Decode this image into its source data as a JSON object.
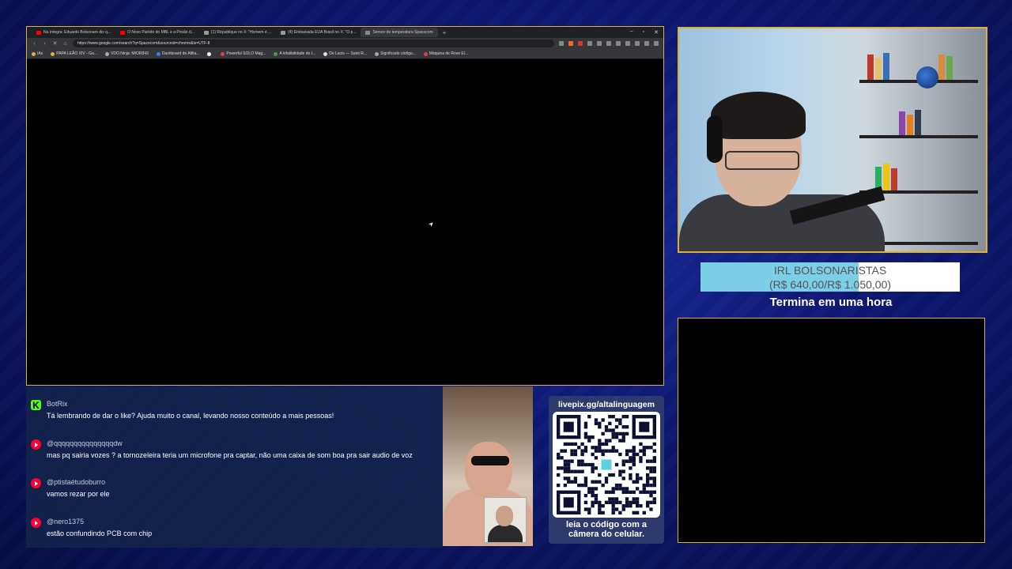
{
  "browser": {
    "tabs": [
      {
        "label": "Na íntegra: Eduardo Bolsonaro diz q...",
        "favicon": "#ff0000",
        "active": false
      },
      {
        "label": "O Novo Partido do MBL e a Prisão d...",
        "favicon": "#ff0000",
        "active": false
      },
      {
        "label": "(1) République no X: \"Homem é ...",
        "favicon": "#999999",
        "active": false
      },
      {
        "label": "(4) Embaixada EUA Brasil no X: \"O p...",
        "favicon": "#999999",
        "active": false
      },
      {
        "label": "Sensor de temperatura Spacecom",
        "favicon": "#888888",
        "active": true
      }
    ],
    "new_tab": "+",
    "window_controls": {
      "minimize": "−",
      "maximize": "▫",
      "close": "✕"
    },
    "nav": {
      "back": "‹",
      "forward": "›",
      "stop": "✕",
      "home": "⌂"
    },
    "url": "https://www.google.com/search?q=Spacecom&sourceid=chrome&ie=UTF-8",
    "bookmarks": [
      {
        "label": "IAs",
        "color": "#e0b040"
      },
      {
        "label": "PAPA LEÃO XIV - Go...",
        "color": "#e0b040"
      },
      {
        "label": "VDO.Ninja: MIOR843",
        "color": "#aaaaaa"
      },
      {
        "label": "Dashboard de Afilia...",
        "color": "#3c7ef0"
      },
      {
        "label": "",
        "color": "#ffffff"
      },
      {
        "label": "Powerful SOLO Mag...",
        "color": "#e04040"
      },
      {
        "label": "A infalibilidade do I...",
        "color": "#40a040"
      },
      {
        "label": "De Lacis — Saint R...",
        "color": "#dddddd"
      },
      {
        "label": "Significado código...",
        "color": "#aaaaaa"
      },
      {
        "label": "Máquina de Rove El...",
        "color": "#e04040"
      }
    ],
    "cursor": "➤"
  },
  "goal": {
    "title": "IRL BOLSONARISTAS",
    "amount": "(R$ 640,00/R$ 1.050,00)",
    "progress": 0.61,
    "ends": "Termina em uma hora",
    "fill_color": "#7ccde6"
  },
  "chat": {
    "messages": [
      {
        "platform": "kick",
        "user": "BotRix",
        "text": "Tá lembrando de dar o like? Ajuda muito o canal, levando nosso conteúdo a mais pessoas!"
      },
      {
        "platform": "youtube",
        "user": "@qqqqqqqqqqqqqqqdw",
        "text": "mas pq sairia vozes ? a tornozeleira teria um microfone pra captar, não uma caixa de som boa pra sair audio de voz"
      },
      {
        "platform": "youtube",
        "user": "@ptistaétudoburro",
        "text": "vamos rezar por ele"
      },
      {
        "platform": "youtube",
        "user": "@nero1375",
        "text": "estão confundindo PCB com chip"
      }
    ]
  },
  "qr": {
    "title": "livepix.gg/altalinguagem",
    "caption_line1": "leia o código com a",
    "caption_line2": "câmera do celular."
  }
}
